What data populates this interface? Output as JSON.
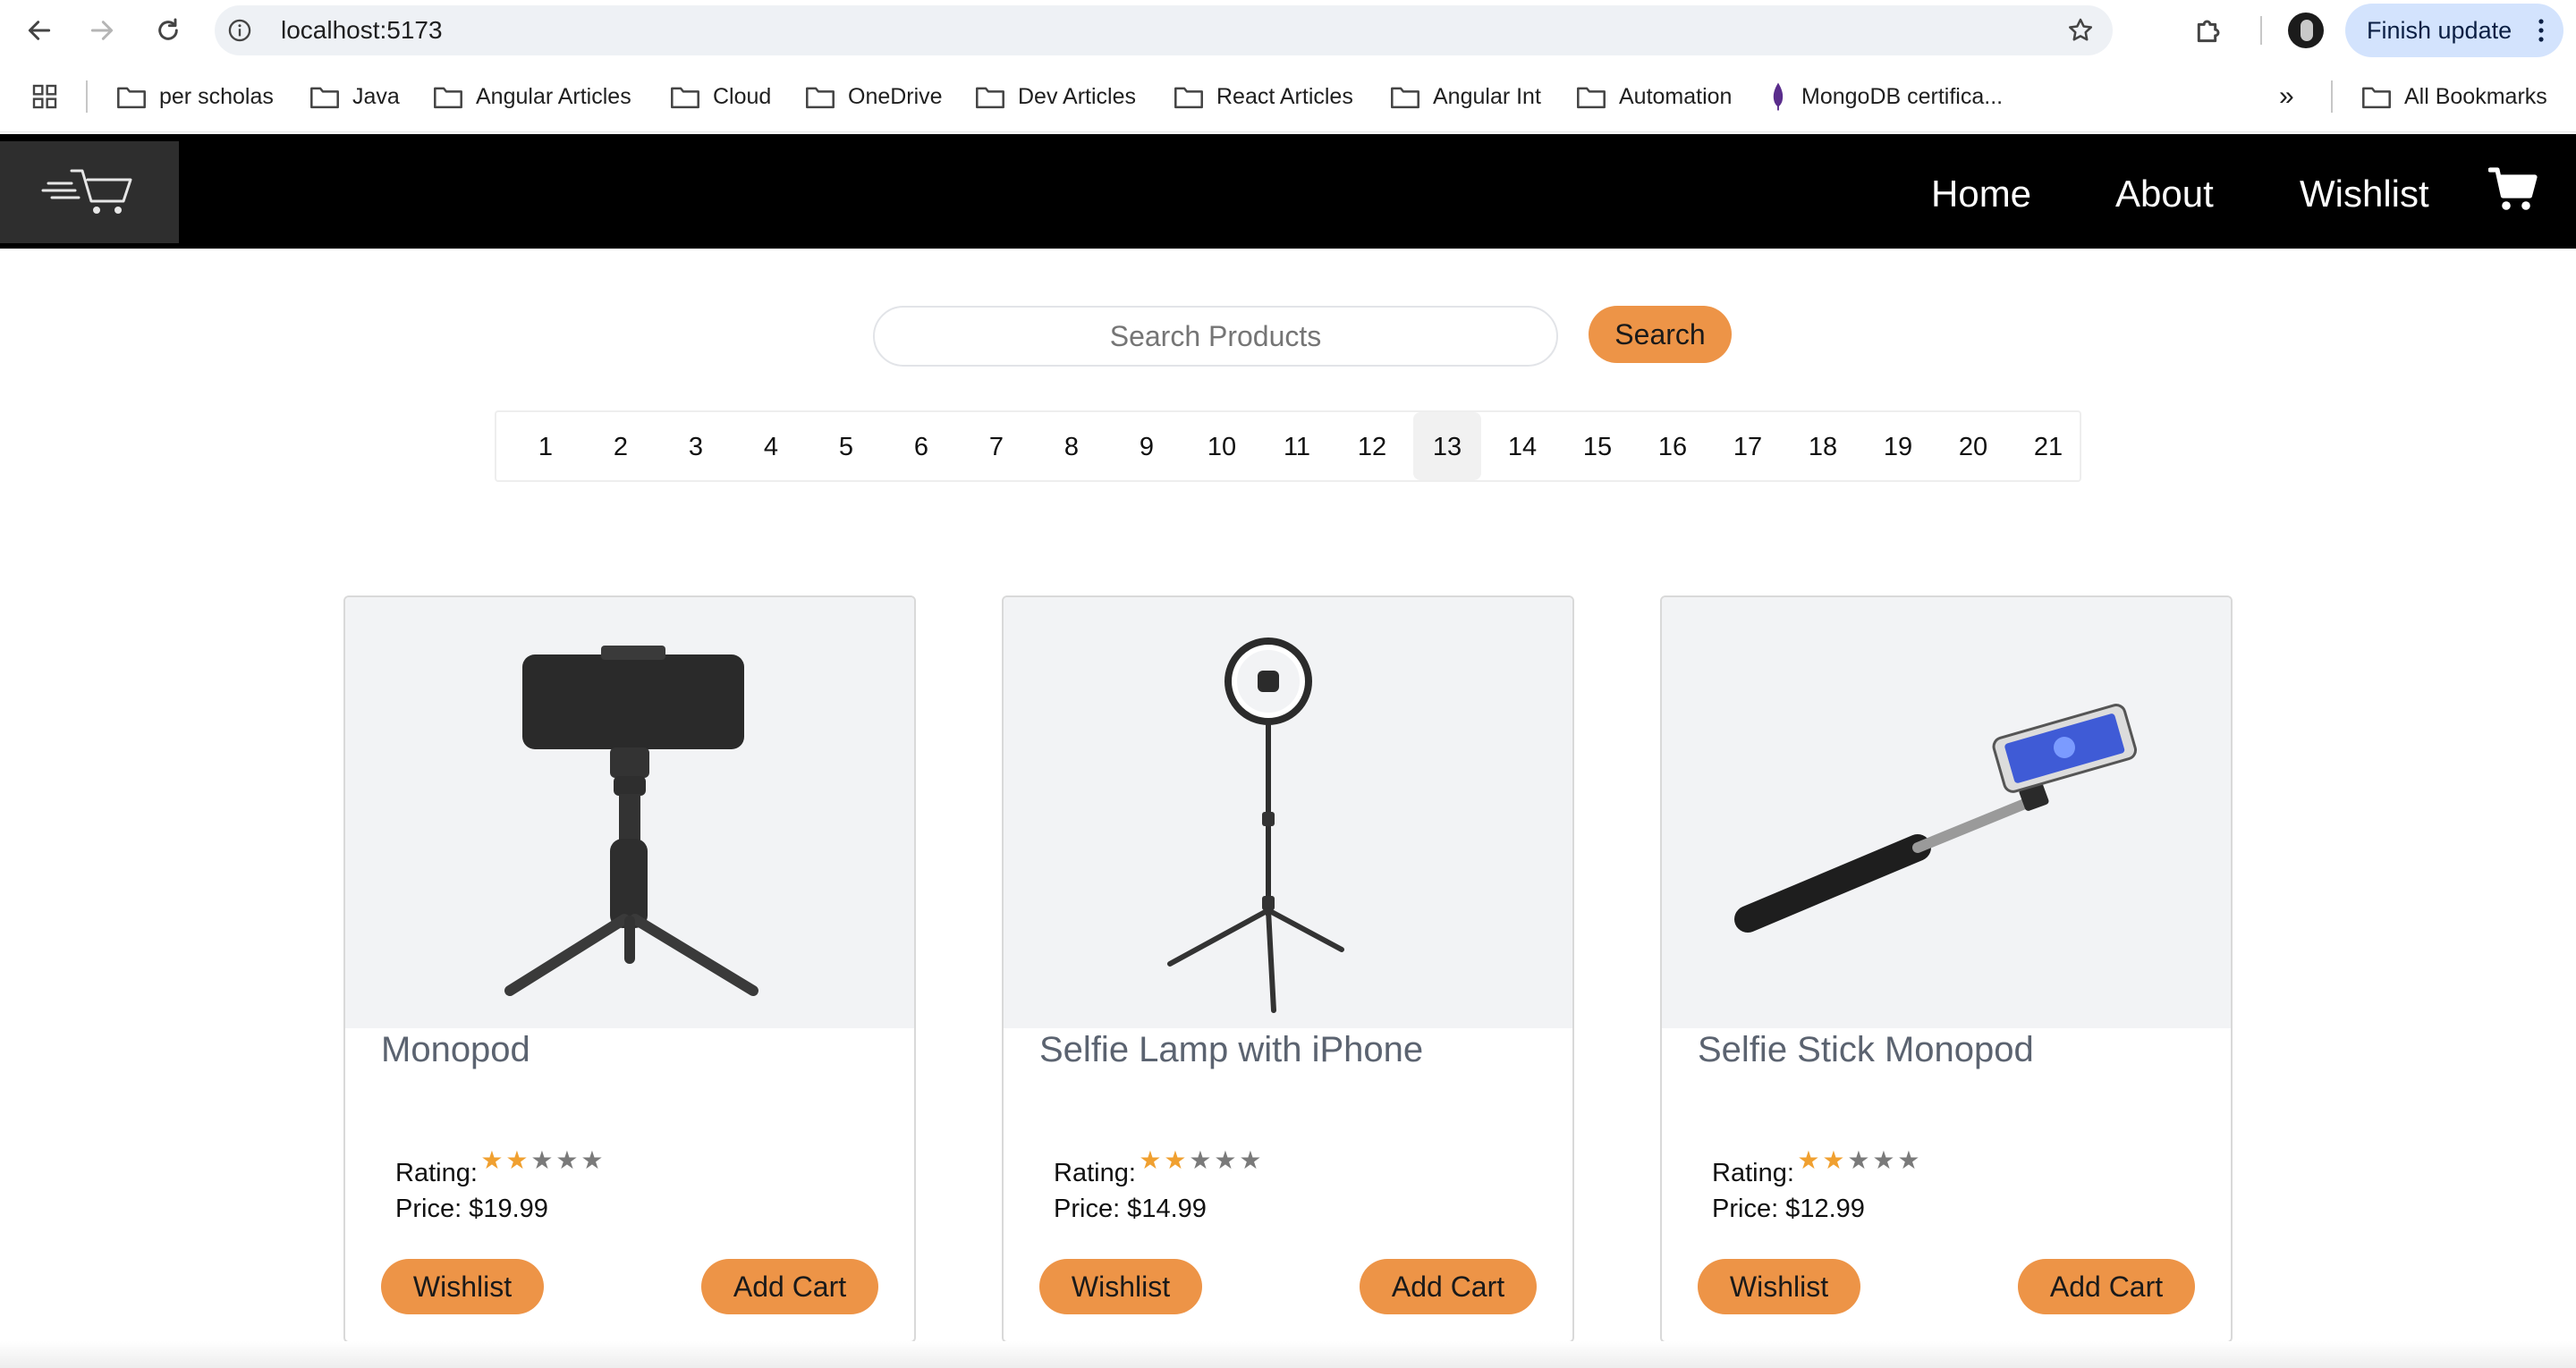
{
  "browser": {
    "url": "localhost:5173",
    "finish_update_label": "Finish update",
    "bookmarks": [
      {
        "label": "per scholas",
        "icon": "folder-icon"
      },
      {
        "label": "Java",
        "icon": "folder-icon"
      },
      {
        "label": "Angular Articles",
        "icon": "folder-icon"
      },
      {
        "label": "Cloud",
        "icon": "folder-icon"
      },
      {
        "label": "OneDrive",
        "icon": "folder-icon"
      },
      {
        "label": "Dev Articles",
        "icon": "folder-icon"
      },
      {
        "label": "React Articles",
        "icon": "folder-icon"
      },
      {
        "label": "Angular Int",
        "icon": "folder-icon"
      },
      {
        "label": "Automation",
        "icon": "folder-icon"
      },
      {
        "label": "MongoDB certifica...",
        "icon": "mongodb-leaf-icon"
      }
    ],
    "overflow_label": "»",
    "all_bookmarks_label": "All Bookmarks"
  },
  "header": {
    "nav": {
      "home": "Home",
      "about": "About",
      "wishlist": "Wishlist"
    },
    "cart_icon": "shopping-cart-icon"
  },
  "search": {
    "placeholder": "Search Products",
    "button_label": "Search"
  },
  "pagination": {
    "pages": [
      "1",
      "2",
      "3",
      "4",
      "5",
      "6",
      "7",
      "8",
      "9",
      "10",
      "11",
      "12",
      "13",
      "14",
      "15",
      "16",
      "17",
      "18",
      "19",
      "20",
      "21"
    ],
    "current": "13"
  },
  "colors": {
    "accent": "#ed9447",
    "header_bg": "#000000",
    "star_filled": "#f0a030",
    "star_empty": "#7a7a7a"
  },
  "products": [
    {
      "name": "Monopod",
      "rating_label": "Rating:",
      "rating": 2,
      "max_rating": 5,
      "price_label": "Price: $19.99",
      "wishlist_label": "Wishlist",
      "cart_label": "Add Cart",
      "image": "tripod-with-phone"
    },
    {
      "name": "Selfie Lamp with iPhone",
      "rating_label": "Rating:",
      "rating": 2,
      "max_rating": 5,
      "price_label": "Price: $14.99",
      "wishlist_label": "Wishlist",
      "cart_label": "Add Cart",
      "image": "ring-light-tripod"
    },
    {
      "name": "Selfie Stick Monopod",
      "rating_label": "Rating:",
      "rating": 2,
      "max_rating": 5,
      "price_label": "Price: $12.99",
      "wishlist_label": "Wishlist",
      "cart_label": "Add Cart",
      "image": "selfie-stick-with-phone"
    }
  ]
}
